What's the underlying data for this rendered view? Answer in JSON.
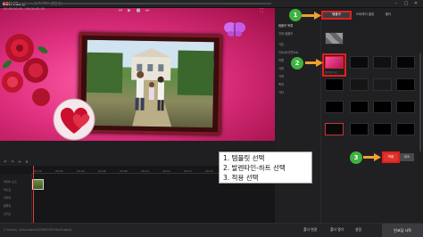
{
  "window": {
    "app_name": "GOM Mix 브",
    "project_title": "새 프로젝트 (편집 중)",
    "minimize": "–",
    "maximize": "□",
    "close": "✕"
  },
  "right_panel": {
    "tabs": [
      "",
      "템플릿",
      "오버레이 클립",
      "필터",
      ""
    ],
    "side_items": [
      "템플릿 목록",
      "전체 템플릿",
      "기본",
      "인트로/아웃트로",
      "여행",
      "사랑",
      "가족",
      "축하",
      "기타"
    ],
    "thumb_labels": [
      "밸런타인-하트",
      "템플릿",
      "템플릿",
      "템플릿",
      "템플릿",
      "템플릿",
      "템플릿",
      "템플릿"
    ],
    "apply_label": "적용",
    "cancel_label": "취소"
  },
  "preview": {
    "time": "00:00:00.00 / 00:00:05.00"
  },
  "timeline": {
    "ticks": [
      "00:00",
      "00:02",
      "00:04",
      "00:06",
      "00:08",
      "00:10",
      "00:12",
      "00:14",
      "00:16",
      "00:18",
      "00:20",
      "00:22",
      "00:24"
    ],
    "tracks": [
      "미디어 소스",
      "텍스트",
      "이미지",
      "템플릿",
      "오디오"
    ]
  },
  "annotations": {
    "circle_1": "1",
    "circle_2": "2",
    "circle_3": "3",
    "step_1": "1.  템플릿 선택",
    "step_2": "2.  발렌타인-하트 선택",
    "step_3": "3.  적용 선택",
    "accent_red": "#e21f1f",
    "accent_green": "#3fb23f"
  },
  "bottom": {
    "file_path": "C:\\Users\\...\\Documents\\GOM\\GOM Mix\\Output\\",
    "folder_change": "폴더 변경",
    "open_folder": "폴더 열기",
    "settings": "설정",
    "export": "인코딩 시작"
  }
}
